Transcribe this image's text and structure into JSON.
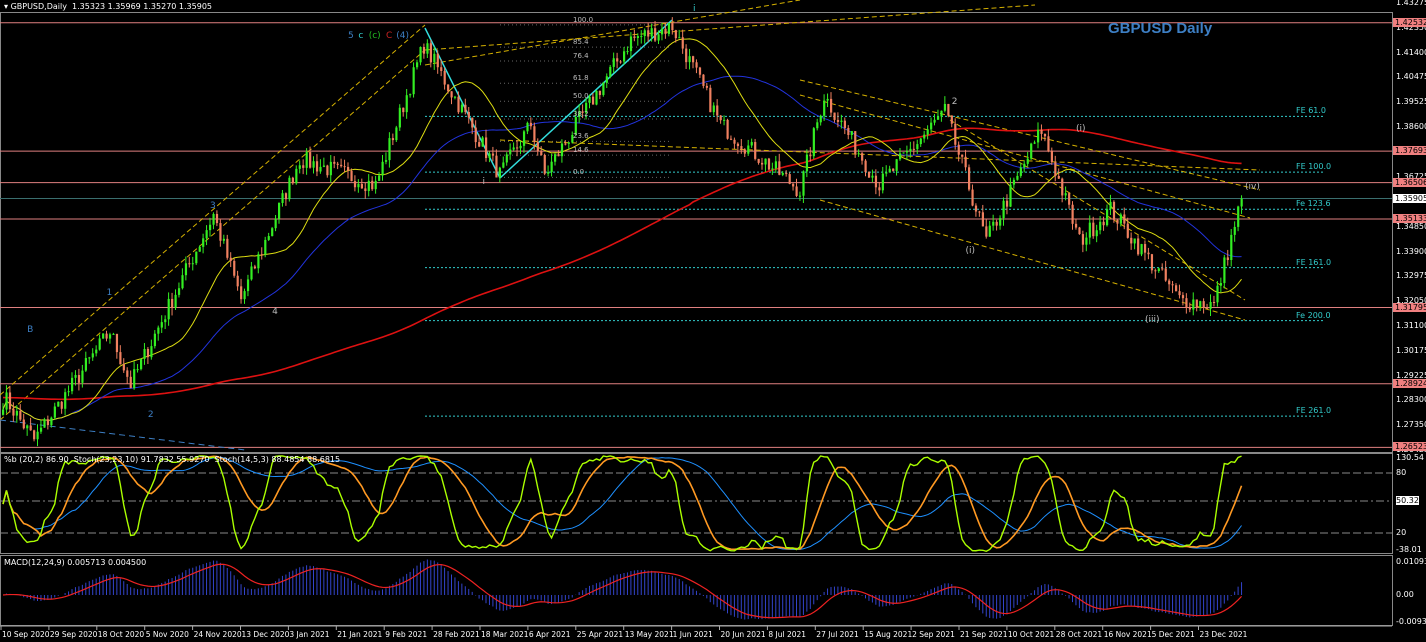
{
  "header": {
    "symbol": "GBPUSD,Daily",
    "ohlc": "1.35323 1.35969 1.35270 1.35905"
  },
  "chart_title": "GBPUSD Daily",
  "stoch_header": "%b (20,2) 86.90  Stoch(23,23,10) 91.7832 55.9270  Stoch(14,5,3) 88.4854 88.6815",
  "macd_header": "MACD(12,24,9) 0.005713 0.004500",
  "price_axis": [
    "1.43275",
    "1.42350",
    "1.41400",
    "1.40475",
    "1.39525",
    "1.38600",
    "1.36725",
    "1.34850",
    "1.33900",
    "1.32975",
    "1.32050",
    "1.31100",
    "1.30175",
    "1.29225",
    "1.28300",
    "1.27350",
    "1.26425"
  ],
  "price_tags": [
    {
      "label": "1.42532",
      "price": 1.42532
    },
    {
      "label": "1.37693",
      "price": 1.37693
    },
    {
      "label": "1.36506",
      "price": 1.36506
    },
    {
      "label": "1.35133",
      "price": 1.35133
    },
    {
      "label": "1.31795",
      "price": 1.31795
    },
    {
      "label": "1.28924",
      "price": 1.28924
    },
    {
      "label": "1.26523",
      "price": 1.26523
    }
  ],
  "current_price": {
    "label": "1.35905",
    "price": 1.35905
  },
  "stoch_axis": [
    "130.54",
    "80",
    "50.32",
    "20",
    "-38.01"
  ],
  "macd_axis": [
    "0.010937",
    "0.00",
    "-0.009374"
  ],
  "dates": [
    "10 Sep 2020",
    "29 Sep 2020",
    "18 Oct 2020",
    "5 Nov 2020",
    "24 Nov 2020",
    "13 Dec 2020",
    "3 Jan 2021",
    "21 Jan 2021",
    "9 Feb 2021",
    "28 Feb 2021",
    "18 Mar 2021",
    "6 Apr 2021",
    "25 Apr 2021",
    "13 May 2021",
    "1 Jun 2021",
    "20 Jun 2021",
    "8 Jul 2021",
    "27 Jul 2021",
    "15 Aug 2021",
    "2 Sep 2021",
    "21 Sep 2021",
    "10 Oct 2021",
    "28 Oct 2021",
    "16 Nov 2021",
    "5 Dec 2021",
    "23 Dec 2021"
  ],
  "fe_levels": [
    {
      "label": "FE 61.0",
      "price": 1.39
    },
    {
      "label": "FE 100.0",
      "price": 1.369
    },
    {
      "label": "Fe 123.6",
      "price": 1.355
    },
    {
      "label": "FE 161.0",
      "price": 1.333
    },
    {
      "label": "Fe 200.0",
      "price": 1.313
    },
    {
      "label": "FE 261.0",
      "price": 1.277
    }
  ],
  "fib_levels": [
    {
      "label": "100.0",
      "price": 1.4245
    },
    {
      "label": "85.4",
      "price": 1.4161
    },
    {
      "label": "76.4",
      "price": 1.4109
    },
    {
      "label": "61.8",
      "price": 1.4025
    },
    {
      "label": "50.0",
      "price": 1.3957
    },
    {
      "label": "38.2",
      "price": 1.389
    },
    {
      "label": "23.6",
      "price": 1.3806
    },
    {
      "label": "14.6",
      "price": 1.3754
    },
    {
      "label": "0.0",
      "price": 1.367
    }
  ],
  "wave_labels": [
    {
      "text": "5",
      "color": "#3d7fc4",
      "bar": 100,
      "price": 1.42
    },
    {
      "text": "c",
      "color": "#33cccc",
      "bar": 103,
      "price": 1.42
    },
    {
      "text": "(c)",
      "color": "#22bb22",
      "bar": 106,
      "price": 1.42
    },
    {
      "text": "C",
      "color": "#cc2222",
      "bar": 111,
      "price": 1.42
    },
    {
      "text": "(4)",
      "color": "#3d7fc4",
      "bar": 114,
      "price": 1.42
    },
    {
      "text": "B",
      "color": "#3d7fc4",
      "bar": 7,
      "price": 1.309
    },
    {
      "text": "1",
      "color": "#3d7fc4",
      "bar": 30,
      "price": 1.323
    },
    {
      "text": "2",
      "color": "#3d7fc4",
      "bar": 42,
      "price": 1.277
    },
    {
      "text": "3",
      "color": "#3d7fc4",
      "bar": 60,
      "price": 1.356
    },
    {
      "text": "4",
      "color": "#bbbbbb",
      "bar": 78,
      "price": 1.316
    },
    {
      "text": "i",
      "color": "#bbbbbb",
      "bar": 139,
      "price": 1.365
    },
    {
      "text": "i",
      "color": "#33cccc",
      "bar": 200,
      "price": 1.43
    },
    {
      "text": "2",
      "color": "#bbbbbb",
      "bar": 275,
      "price": 1.395
    },
    {
      "text": "(i)",
      "color": "#bbbbbb",
      "bar": 311,
      "price": 1.385
    },
    {
      "text": "(i)",
      "color": "#bbbbbb",
      "bar": 279,
      "price": 1.339
    },
    {
      "text": "(iii)",
      "color": "#bbbbbb",
      "bar": 331,
      "price": 1.313
    },
    {
      "text": "(iv)",
      "color": "#bbbbbb",
      "bar": 360,
      "price": 1.363
    }
  ],
  "chart_data": {
    "type": "candlestick",
    "title": "GBPUSD Daily",
    "ylim": [
      1.26425,
      1.43275
    ],
    "pivots": [
      [
        1,
        1.283
      ],
      [
        9,
        1.268
      ],
      [
        31,
        1.309
      ],
      [
        37,
        1.289
      ],
      [
        61,
        1.353
      ],
      [
        69,
        1.321
      ],
      [
        86,
        1.374
      ],
      [
        108,
        1.364
      ],
      [
        122,
        1.417
      ],
      [
        144,
        1.368
      ],
      [
        153,
        1.387
      ],
      [
        157,
        1.368
      ],
      [
        182,
        1.419
      ],
      [
        194,
        1.424
      ],
      [
        208,
        1.387
      ],
      [
        231,
        1.362
      ],
      [
        238,
        1.398
      ],
      [
        254,
        1.364
      ],
      [
        273,
        1.392
      ],
      [
        285,
        1.343
      ],
      [
        301,
        1.385
      ],
      [
        312,
        1.343
      ],
      [
        321,
        1.355
      ],
      [
        341,
        1.321
      ],
      [
        351,
        1.319
      ],
      [
        359,
        1.359
      ]
    ],
    "colors": {
      "bull": "#33ee22",
      "bear": "#f08060",
      "ma_long": "#dd1111",
      "ma_mid": "#2233dd",
      "ma_short": "#dddd11",
      "fe": "#33cccc",
      "level": "#e08080",
      "stoch_fast": "#aaff00",
      "stoch_slow": "#ff9922",
      "stoch_base": "#1e90ff",
      "macd": "#3344cc",
      "signal": "#ee2222"
    }
  }
}
